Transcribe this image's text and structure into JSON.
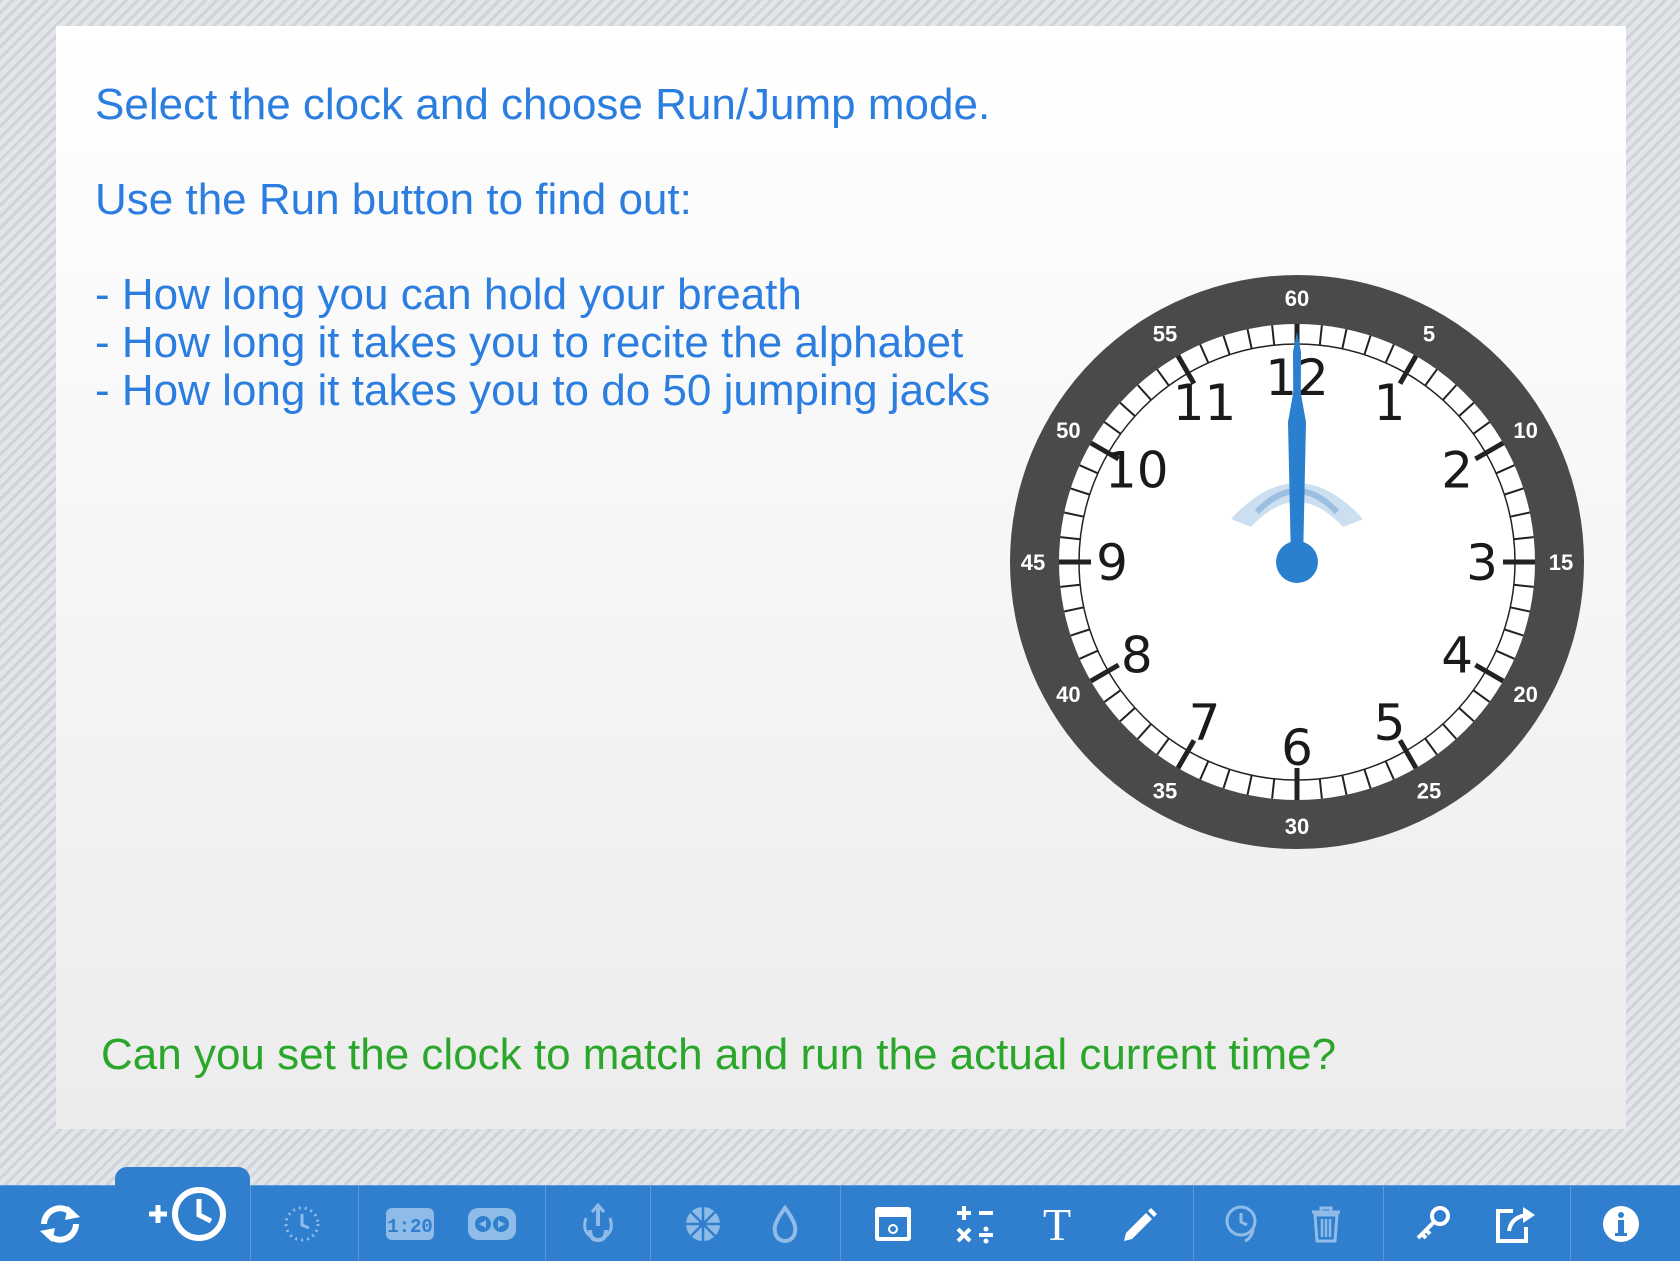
{
  "instructions": {
    "line1": "Select the clock and choose Run/Jump mode.",
    "line2": "Use the Run button to find out:",
    "bullets": [
      "- How long you can hold your breath",
      "- How long it takes you to recite the alphabet",
      "- How long it takes you to do 50 jumping jacks"
    ]
  },
  "question": "Can you set the clock to match and run the actual current time?",
  "clock": {
    "hour_labels": [
      "12",
      "1",
      "2",
      "3",
      "4",
      "5",
      "6",
      "7",
      "8",
      "9",
      "10",
      "11"
    ],
    "minute_labels": [
      "60",
      "5",
      "10",
      "15",
      "20",
      "25",
      "30",
      "35",
      "40",
      "45",
      "50",
      "55"
    ],
    "time_shown": "12:00",
    "colors": {
      "hands": "#2b7fcf",
      "bezel": "#4a4a4a",
      "face": "#ffffff",
      "numerals": "#1a1a1a"
    }
  },
  "toolbar": {
    "colors": {
      "bar": "#2f7fce",
      "icon": "#ffffff",
      "disabled_icon": "#8fbbe8"
    },
    "items": [
      {
        "name": "refresh-icon",
        "enabled": true
      },
      {
        "name": "add-clock-icon",
        "enabled": true
      },
      {
        "name": "clock-face-icon",
        "enabled": false
      },
      {
        "name": "digital-time-icon",
        "enabled": false
      },
      {
        "name": "run-jump-icon",
        "enabled": false
      },
      {
        "name": "set-time-icon",
        "enabled": false
      },
      {
        "name": "segment-icon",
        "enabled": false
      },
      {
        "name": "color-drop-icon",
        "enabled": false
      },
      {
        "name": "background-icon",
        "enabled": true
      },
      {
        "name": "calculator-icon",
        "enabled": true
      },
      {
        "name": "text-icon",
        "enabled": true
      },
      {
        "name": "pen-icon",
        "enabled": true
      },
      {
        "name": "clock-history-icon",
        "enabled": false
      },
      {
        "name": "trash-icon",
        "enabled": false
      },
      {
        "name": "key-icon",
        "enabled": true
      },
      {
        "name": "share-icon",
        "enabled": true
      },
      {
        "name": "info-icon",
        "enabled": true
      }
    ]
  }
}
